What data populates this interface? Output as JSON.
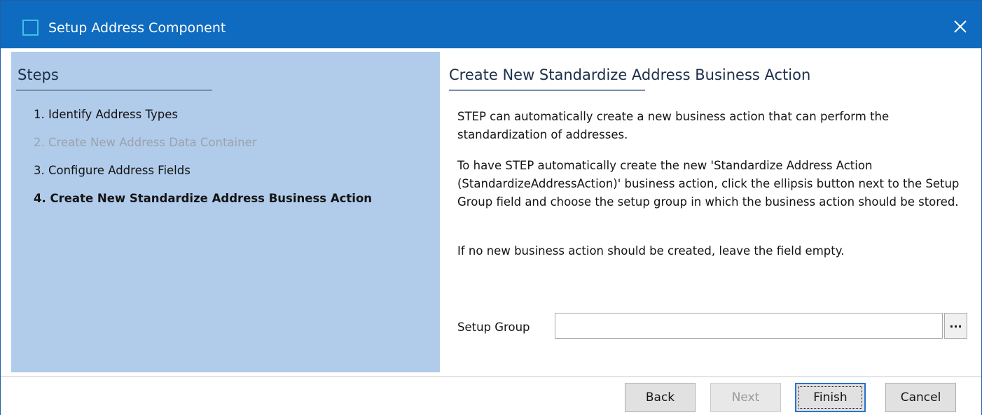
{
  "window": {
    "title": "Setup Address Component",
    "close_icon": "close-icon",
    "app_icon": "window-icon"
  },
  "steps": {
    "heading": "Steps",
    "items": [
      {
        "label": "1. Identify Address Types",
        "state": "enabled"
      },
      {
        "label": "2. Create New Address Data Container",
        "state": "disabled"
      },
      {
        "label": "3. Configure Address Fields",
        "state": "enabled"
      },
      {
        "label": "4. Create New Standardize Address Business Action",
        "state": "current"
      }
    ]
  },
  "main": {
    "heading": "Create New Standardize Address Business Action",
    "paragraphs": [
      "STEP can automatically create a new business action that can perform the standardization of addresses.",
      "To have STEP automatically create the new 'Standardize Address Action (StandardizeAddressAction)' business action, click the ellipsis button next to the Setup Group field and choose the setup group in which the business action should be stored.",
      "If no new business action should be created, leave the field empty."
    ],
    "setup_group": {
      "label": "Setup Group",
      "value": "",
      "browse_label": "..."
    }
  },
  "buttons": {
    "back": "Back",
    "next": "Next",
    "finish": "Finish",
    "cancel": "Cancel"
  },
  "colors": {
    "titlebar": "#0e6bbf",
    "steps_panel": "#b1cbea",
    "default_button_border": "#2a73c9"
  }
}
